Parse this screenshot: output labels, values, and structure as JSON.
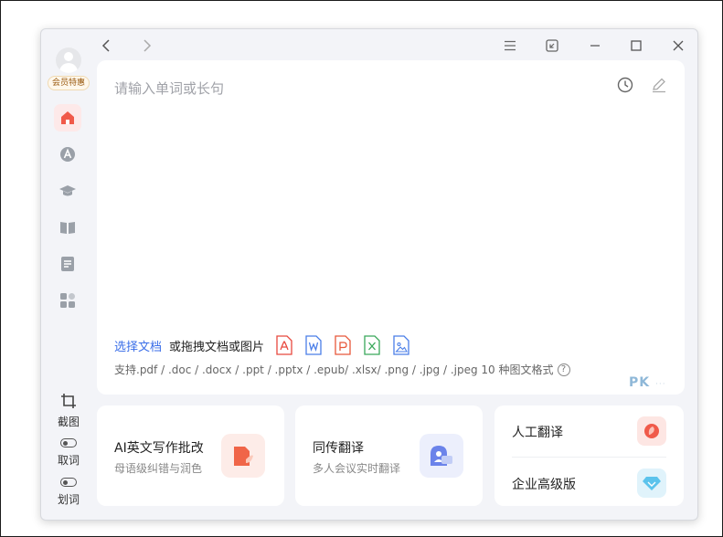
{
  "sidebar": {
    "vip_label": "会员特惠",
    "nav_items": [
      {
        "id": "home",
        "icon": "home-icon",
        "active": true
      },
      {
        "id": "dictionary",
        "icon": "dictionary-icon",
        "active": false
      },
      {
        "id": "courses",
        "icon": "graduation-cap-icon",
        "active": false
      },
      {
        "id": "wordbook",
        "icon": "book-icon",
        "active": false
      },
      {
        "id": "notes",
        "icon": "note-icon",
        "active": false
      },
      {
        "id": "apps",
        "icon": "apps-grid-icon",
        "active": false
      }
    ],
    "tools": {
      "screenshot_label": "截图",
      "pick_word_label": "取词",
      "select_word_label": "划词"
    }
  },
  "input": {
    "placeholder": "请输入单词或长句",
    "select_doc_link": "选择文档",
    "drag_text": "或拖拽文档或图片",
    "formats_text": "支持.pdf / .doc / .docx / .ppt / .pptx / .epub/ .xlsx/ .png / .jpg / .jpeg  10 种图文格式",
    "help_glyph": "?"
  },
  "watermark": {
    "text": "PK",
    "sub": "···"
  },
  "cards": {
    "ai_writing": {
      "title": "AI英文写作批改",
      "subtitle": "母语级纠错与润色"
    },
    "simultaneous": {
      "title": "同传翻译",
      "subtitle": "多人会议实时翻译"
    },
    "human_translation": {
      "title": "人工翻译"
    },
    "enterprise": {
      "title": "企业高级版"
    }
  },
  "colors": {
    "accent_red": "#f05a4a",
    "link_blue": "#3a6ee8",
    "pdf": "#e8493f",
    "word": "#4a7ee8",
    "ppt": "#e8583a",
    "excel": "#39a85a",
    "image": "#4a7ee8"
  }
}
